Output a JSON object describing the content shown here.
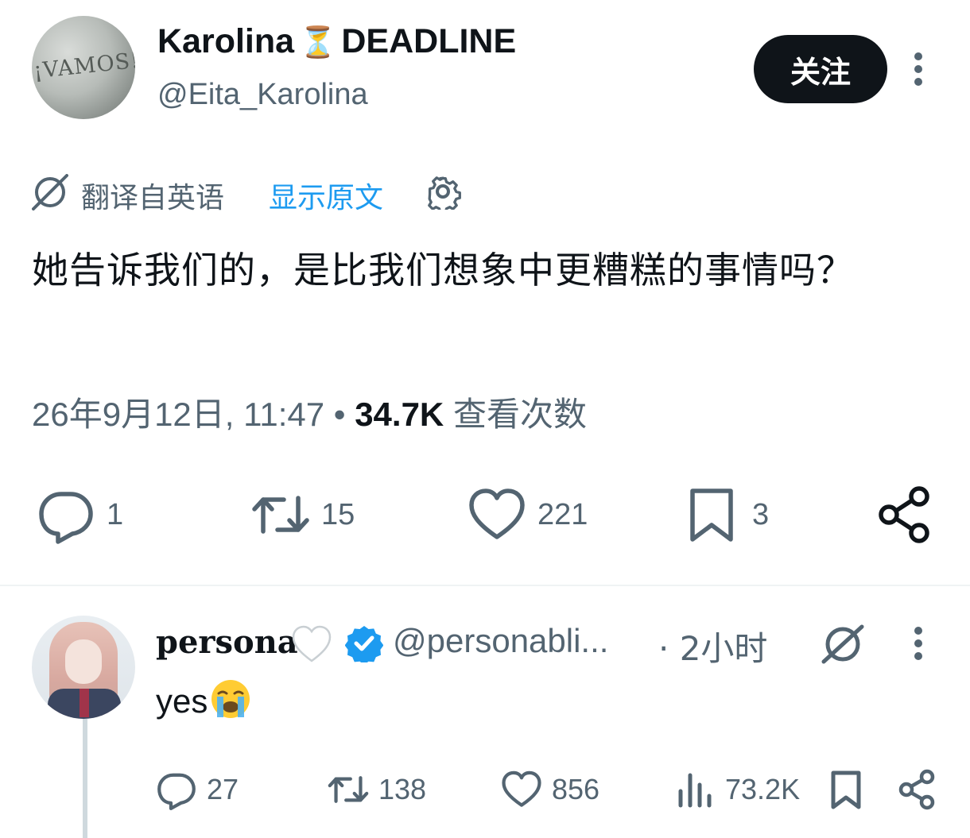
{
  "tweet": {
    "author_name": "Karolina",
    "author_name_suffix": "DEADLINE",
    "author_emoji": "⏳",
    "author_handle": "@Eita_Karolina",
    "avatar_text": "¡VAMOS!",
    "follow_label": "关注",
    "translated_label": "翻译自英语",
    "show_original_label": "显示原文",
    "text": "她告诉我们的，是比我们想象中更糟糕的事情吗？",
    "timestamp": "26年9月12日, 11:47",
    "separator": "•",
    "views_count": "34.7K",
    "views_label": "查看次数",
    "replies": "1",
    "retweets": "15",
    "likes": "221",
    "bookmarks": "3"
  },
  "reply": {
    "author_name": "persona",
    "author_handle": "@personabli...",
    "time": "· 2小时",
    "text": "yes",
    "replies": "27",
    "retweets": "138",
    "likes": "856",
    "views": "73.2K"
  },
  "colors": {
    "text_primary": "#0f1419",
    "text_secondary": "#536471",
    "link": "#1d9bf0",
    "verified": "#1d9bf0",
    "divider": "#eff3f4"
  },
  "icons": [
    "globe-slash-icon",
    "gear-icon",
    "more-icon",
    "reply-icon",
    "retweet-icon",
    "like-icon",
    "bookmark-icon",
    "share-icon",
    "views-icon",
    "verified-icon",
    "white-heart-icon",
    "crying-emoji"
  ]
}
